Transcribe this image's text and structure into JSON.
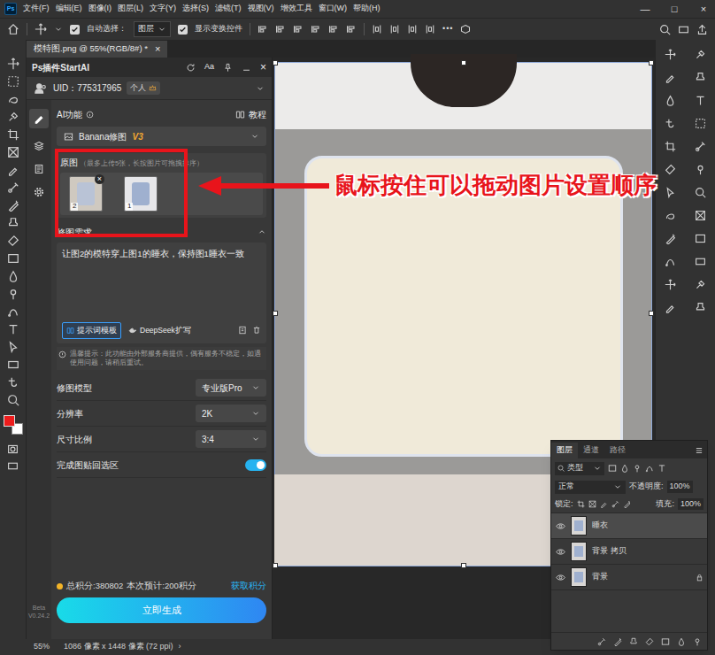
{
  "app": {
    "logo": "Ps",
    "menu": [
      "文件(F)",
      "编辑(E)",
      "图像(I)",
      "图层(L)",
      "文字(Y)",
      "选择(S)",
      "滤镜(T)",
      "视图(V)",
      "增效工具",
      "窗口(W)",
      "帮助(H)"
    ],
    "window_controls": [
      "—",
      "□",
      "×"
    ]
  },
  "options_bar": {
    "auto_select_label": "自动选择：",
    "auto_select_checked": true,
    "target": "图层",
    "show_transform_label": "显示变换控件",
    "show_transform_checked": true,
    "more": "•••"
  },
  "document_tab": {
    "title": "模特图.png @ 55%(RGB/8#) *",
    "close": "×"
  },
  "toolbar": {
    "swatches": [
      {
        "color": "#ee1c1c"
      },
      {
        "color": "#ffffff"
      }
    ]
  },
  "plugin": {
    "title": "Ps插件StartAI",
    "font_button": "Aa",
    "close": "×",
    "uid": "UID：775317965",
    "account": "个人",
    "ai_label": "AI功能",
    "tutorial": "教程",
    "feature": "Banana修图",
    "feature_version": "V3",
    "source_label": "原图",
    "source_hint": "（最多上传5张，长按图片可拖拽排序）",
    "remove_glyph": "×",
    "images": [
      {
        "index": "2",
        "removable": true
      },
      {
        "index": "1",
        "removable": false
      }
    ],
    "prompt_label": "修图需求",
    "prompt_expanded": true,
    "prompt": "让图2的模特穿上图1的睡衣，保持图1睡衣一致",
    "template_button": "提示词模板",
    "expand_button": "DeepSeek扩写",
    "notice": "温馨提示：此功能由外部服务商提供，偶有服务不稳定，如遇使用问题，请稍后重试。",
    "settings": [
      {
        "kind": "select",
        "label": "修图模型",
        "value": "专业版Pro"
      },
      {
        "kind": "select",
        "label": "分辨率",
        "value": "2K"
      },
      {
        "kind": "select",
        "label": "尺寸比例",
        "value": "3:4"
      },
      {
        "kind": "toggle",
        "label": "完成图贴回选区",
        "on": true
      }
    ],
    "points": "总积分:380802",
    "estimate": "本次预计:200积分",
    "get_points": "获取积分",
    "generate": "立即生成",
    "version": [
      "Beta",
      "V0.24.2"
    ]
  },
  "layers_panel": {
    "tabs": [
      {
        "label": "图层",
        "selected": true
      },
      {
        "label": "通道",
        "selected": false
      },
      {
        "label": "路径",
        "selected": false
      }
    ],
    "filter": "类型",
    "blend": "正常",
    "opacity_label": "不透明度:",
    "opacity": "100%",
    "lock_label": "锁定:",
    "fill_label": "填充:",
    "fill": "100%",
    "layers": [
      {
        "name": "睡衣",
        "visible": true,
        "selected": true,
        "locked": false
      },
      {
        "name": "背景 拷贝",
        "visible": true,
        "selected": false,
        "locked": false
      },
      {
        "name": "背景",
        "visible": true,
        "selected": false,
        "locked": true
      }
    ]
  },
  "status_bar": {
    "zoom": "55%",
    "info": "1086 像素 x 1448 像素 (72 ppi)",
    "arrow": "›"
  },
  "annotation": {
    "text": "鼠标按住可以拖动图片设置顺序"
  }
}
